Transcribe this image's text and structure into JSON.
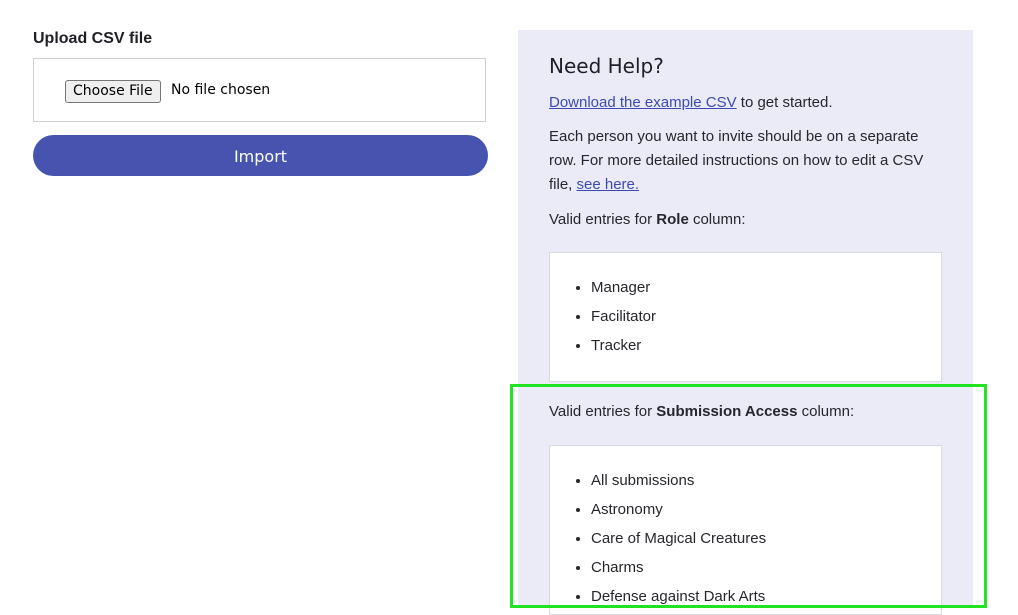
{
  "upload": {
    "label": "Upload CSV file",
    "choose_button": "Choose File",
    "file_status": "No file chosen",
    "import_button": "Import"
  },
  "help": {
    "title": "Need Help?",
    "download_link": "Download the example CSV",
    "download_suffix": " to get started.",
    "instructions_prefix": "Each person you want to invite should be on a separate row. For more detailed instructions on how to edit a CSV file, ",
    "instructions_link": "see here.",
    "role_prefix": "Valid entries for ",
    "role_bold": "Role",
    "role_suffix": " column:",
    "roles": [
      "Manager",
      "Facilitator",
      "Tracker"
    ],
    "access_prefix": "Valid entries for ",
    "access_bold": "Submission Access",
    "access_suffix": " column:",
    "access_entries": [
      "All submissions",
      "Astronomy",
      "Care of Magical Creatures",
      "Charms",
      "Defense against Dark Arts"
    ]
  },
  "colors": {
    "primary": "#4654b0",
    "panel_bg": "#ebebf8",
    "highlight": "#22e322",
    "link": "#3c4ab6"
  }
}
